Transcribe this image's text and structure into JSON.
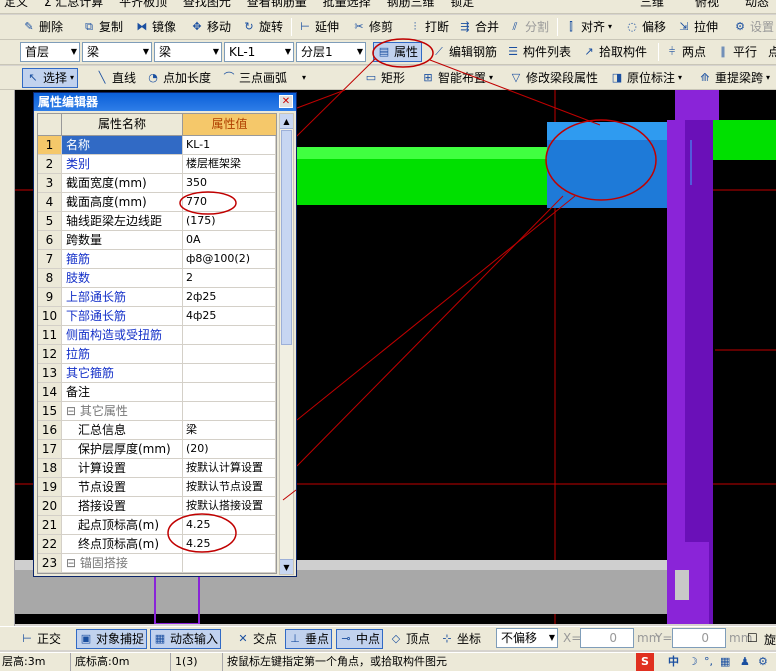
{
  "toolbar1": [
    "定义",
    "Σ 汇总计算",
    "平齐板顶",
    "查找图元",
    "查看钢筋量",
    "批量选择",
    "钢筋三维",
    "锁定",
    "三维",
    "俯视",
    "动态"
  ],
  "toolbar2": {
    "delete": "删除",
    "copy": "复制",
    "mirror": "镜像",
    "move": "移动",
    "rotate": "旋转",
    "extend": "延伸",
    "trim": "修剪",
    "break": "打断",
    "merge": "合并",
    "split": "分割",
    "align": "对齐",
    "offset": "偏移",
    "stretch": "拉伸",
    "settings": "设置"
  },
  "toolbar3": {
    "floor": "首层",
    "type1": "梁",
    "type2": "梁",
    "name": "KL-1",
    "layer": "分层1",
    "property": "属性",
    "edit_rebar": "编辑钢筋",
    "component_list": "构件列表",
    "pick": "拾取构件",
    "two_points": "两点",
    "parallel": "平行",
    "extra": "点"
  },
  "toolbar4": {
    "select": "选择",
    "line": "直线",
    "point_length": "点加长度",
    "arc": "三点画弧",
    "rect": "矩形",
    "smart": "智能布置",
    "modify_segment": "修改梁段属性",
    "in_situ": "原位标注",
    "relift": "重提梁跨"
  },
  "panel": {
    "title": "属性编辑器",
    "col_name": "属性名称",
    "col_value": "属性值",
    "rows": [
      {
        "no": "1",
        "name": "名称",
        "value": "KL-1",
        "cls": "blue"
      },
      {
        "no": "2",
        "name": "类别",
        "value": "楼层框架梁",
        "cls": "blue"
      },
      {
        "no": "3",
        "name": "截面宽度(mm)",
        "value": "350",
        "cls": ""
      },
      {
        "no": "4",
        "name": "截面高度(mm)",
        "value": "770",
        "cls": ""
      },
      {
        "no": "5",
        "name": "轴线距梁左边线距",
        "value": "(175)",
        "cls": ""
      },
      {
        "no": "6",
        "name": "跨数量",
        "value": "0A",
        "cls": ""
      },
      {
        "no": "7",
        "name": "箍筋",
        "value": "ф8@100(2)",
        "cls": "blue"
      },
      {
        "no": "8",
        "name": "肢数",
        "value": "2",
        "cls": "blue"
      },
      {
        "no": "9",
        "name": "上部通长筋",
        "value": "2ф25",
        "cls": "blue"
      },
      {
        "no": "10",
        "name": "下部通长筋",
        "value": "4ф25",
        "cls": "blue"
      },
      {
        "no": "11",
        "name": "侧面构造或受扭筋",
        "value": "",
        "cls": "blue"
      },
      {
        "no": "12",
        "name": "拉筋",
        "value": "",
        "cls": "blue"
      },
      {
        "no": "13",
        "name": "其它箍筋",
        "value": "",
        "cls": "blue"
      },
      {
        "no": "14",
        "name": "备注",
        "value": "",
        "cls": ""
      },
      {
        "no": "15",
        "name": "⊟ 其它属性",
        "value": "",
        "cls": "grey"
      },
      {
        "no": "16",
        "name": "　汇总信息",
        "value": "梁",
        "cls": ""
      },
      {
        "no": "17",
        "name": "　保护层厚度(mm)",
        "value": "(20)",
        "cls": ""
      },
      {
        "no": "18",
        "name": "　计算设置",
        "value": "按默认计算设置",
        "cls": ""
      },
      {
        "no": "19",
        "name": "　节点设置",
        "value": "按默认节点设置",
        "cls": ""
      },
      {
        "no": "20",
        "name": "　搭接设置",
        "value": "按默认搭接设置",
        "cls": ""
      },
      {
        "no": "21",
        "name": "　起点顶标高(m)",
        "value": "4.25",
        "cls": ""
      },
      {
        "no": "22",
        "name": "　终点顶标高(m)",
        "value": "4.25",
        "cls": ""
      },
      {
        "no": "23",
        "name": "⊟ 锚固搭接",
        "value": "",
        "cls": "grey"
      }
    ]
  },
  "bottom": {
    "ortho": "正交",
    "snap": "对象捕捉",
    "dyn": "动态输入",
    "cross": "交点",
    "perp": "垂点",
    "mid": "中点",
    "vertex": "顶点",
    "coord": "坐标",
    "offset": "不偏移",
    "x_label": "X=",
    "x_val": "0",
    "y_label": "Y=",
    "y_val": "0",
    "unit": "mm",
    "rotate": "旋"
  },
  "status": {
    "floor_h": "层高:3m",
    "base_h": "底标高:0m",
    "count": "1(3)",
    "hint": "按鼠标左键指定第一个角点，或拾取构件图元",
    "ime": "中"
  }
}
